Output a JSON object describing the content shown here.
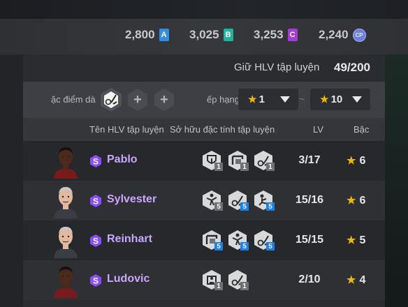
{
  "currencies": [
    {
      "amount": "2,800",
      "badge": "A",
      "color": "#2f8fe6"
    },
    {
      "amount": "3,025",
      "badge": "B",
      "color": "#1fb3a0"
    },
    {
      "amount": "3,253",
      "badge": "C",
      "color": "#a43cd6"
    },
    {
      "amount": "2,240",
      "badge": "CP",
      "color": "#6b7fe0"
    }
  ],
  "capacity": {
    "label": "Giữ HLV tập luyện",
    "value": "49/200"
  },
  "filters": {
    "trait_label": "ặc điểm dà",
    "rank_label": "ếp hạng",
    "min_grade": "1",
    "max_grade": "10",
    "range_separator": "~"
  },
  "columns": {
    "name": "Tên HLV tập luyện",
    "traits": "Sở hữu đặc tính tập luyện",
    "level": "LV",
    "grade": "Bậc"
  },
  "rows": [
    {
      "name": "Pablo",
      "level": "3/17",
      "grade": "6",
      "skin": "dark",
      "traits": [
        {
          "icon": "shield-trait-icon",
          "level": "1",
          "color": "#6e7075"
        },
        {
          "icon": "wall-trait-icon",
          "level": "1",
          "color": "#6e7075"
        },
        {
          "icon": "dribble-trait-icon",
          "level": "1",
          "color": "#6e7075"
        }
      ]
    },
    {
      "name": "Sylvester",
      "level": "15/16",
      "grade": "6",
      "skin": "light",
      "traits": [
        {
          "icon": "leap-trait-icon",
          "level": "5",
          "color": "#6e7075"
        },
        {
          "icon": "dribble-trait-icon",
          "level": "5",
          "color": "#1f7fe8"
        },
        {
          "icon": "kick-trait-icon",
          "level": "5",
          "color": "#1f7fe8"
        }
      ]
    },
    {
      "name": "Reinhart",
      "level": "15/15",
      "grade": "5",
      "skin": "light",
      "traits": [
        {
          "icon": "wall-trait-icon",
          "level": "5",
          "color": "#1f7fe8"
        },
        {
          "icon": "leap-trait-icon",
          "level": "5",
          "color": "#1f7fe8"
        },
        {
          "icon": "dribble-trait-icon",
          "level": "5",
          "color": "#1f7fe8"
        }
      ]
    },
    {
      "name": "Ludovic",
      "level": "2/10",
      "grade": "4",
      "skin": "dark",
      "traits": [
        {
          "icon": "keeper-trait-icon",
          "level": "1",
          "color": "#6e7075"
        },
        {
          "icon": "dribble-trait-icon",
          "level": "1",
          "color": "#6e7075"
        }
      ]
    }
  ]
}
